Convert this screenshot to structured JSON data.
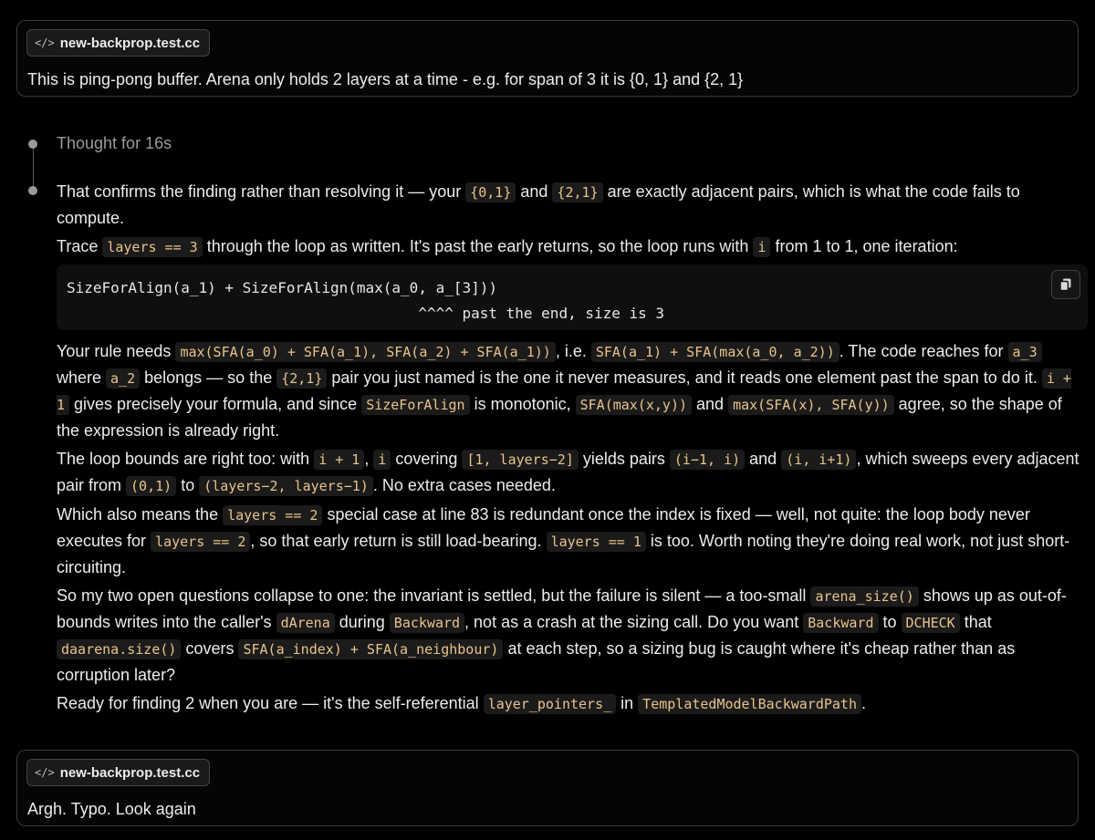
{
  "messages": [
    {
      "file_chip": "new-backprop.test.cc",
      "text": "This is ping-pong buffer. Arena only holds 2 layers at a time - e.g. for span of 3 it is {0, 1} and {2, 1}"
    },
    {
      "file_chip": "new-backprop.test.cc",
      "text": "Argh. Typo. Look again"
    }
  ],
  "thought_label": "Thought for 16s",
  "code_block": {
    "line1": "SizeForAlign(a_1) + SizeForAlign(max(a_0, a_[3]))",
    "line2": "                                        ^^^^ past the end, size is 3"
  },
  "response": {
    "p1": {
      "t1": "That confirms the finding rather than resolving it — your ",
      "c1": "{0,1}",
      "t2": " and ",
      "c2": "{2,1}",
      "t3": " are exactly adjacent pairs, which is what the code fails to compute."
    },
    "p2": {
      "t1": "Trace ",
      "c1": "layers == 3",
      "t2": " through the loop as written. It's past the early returns, so the loop runs with ",
      "c2": "i",
      "t3": " from 1 to 1, one iteration:"
    },
    "p3": {
      "t1": "Your rule needs ",
      "c1": "max(SFA(a_0) + SFA(a_1), SFA(a_2) + SFA(a_1))",
      "t2": ", i.e. ",
      "c2": "SFA(a_1) + SFA(max(a_0, a_2))",
      "t3": ". The code reaches for ",
      "c3": "a_3",
      "t4": " where ",
      "c4": "a_2",
      "t5": " belongs — so the ",
      "c5": "{2,1}",
      "t6": " pair you just named is the one it never measures, and it reads one element past the span to do it. ",
      "c6": "i + 1",
      "t7": " gives precisely your formula, and since ",
      "c7": "SizeForAlign",
      "t8": " is monotonic, ",
      "c8": "SFA(max(x,y))",
      "t9": " and ",
      "c9": "max(SFA(x), SFA(y))",
      "t10": " agree, so the shape of the expression is already right."
    },
    "p4": {
      "t1": "The loop bounds are right too: with ",
      "c1": "i + 1",
      "t2": ", ",
      "c2": "i",
      "t3": " covering ",
      "c3": "[1, layers−2]",
      "t4": " yields pairs ",
      "c4": "(i−1, i)",
      "t5": " and ",
      "c5": "(i, i+1)",
      "t6": ", which sweeps every adjacent pair from ",
      "c6": "(0,1)",
      "t7": " to ",
      "c7": "(layers−2, layers−1)",
      "t8": ". No extra cases needed."
    },
    "p5": {
      "t1": "Which also means the ",
      "c1": "layers == 2",
      "t2": " special case at line 83 is redundant once the index is fixed — well, not quite: the loop body never executes for ",
      "c2": "layers == 2",
      "t3": ", so that early return is still load-bearing. ",
      "c3": "layers == 1",
      "t4": " is too. Worth noting they're doing real work, not just short-circuiting."
    },
    "p6": {
      "t1": "So my two open questions collapse to one: the invariant is settled, but the failure is silent — a too-small ",
      "c1": "arena_size()",
      "t2": " shows up as out-of-bounds writes into the caller's ",
      "c2": "dArena",
      "t3": " during ",
      "c3": "Backward",
      "t4": ", not as a crash at the sizing call. Do you want ",
      "c4": "Backward",
      "t5": " to ",
      "c5": "DCHECK",
      "t6": " that ",
      "c6": "daarena.size()",
      "t7": " covers ",
      "c7": "SFA(a_index) + SFA(a_neighbour)",
      "t8": " at each step, so a sizing bug is caught where it's cheap rather than as corruption later?"
    },
    "p7": {
      "t1": "Ready for finding 2 when you are — it's the self-referential ",
      "c1": "layer_pointers_",
      "t2": " in ",
      "c2": "TemplatedModelBackwardPath",
      "t3": "."
    }
  }
}
